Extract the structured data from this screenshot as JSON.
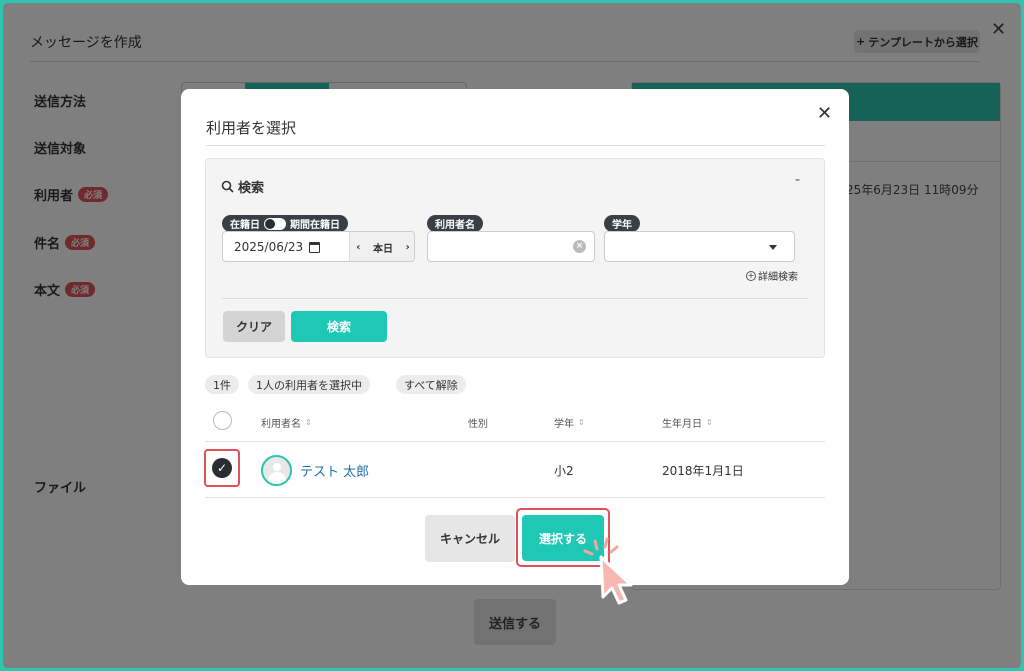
{
  "page": {
    "title": "メッセージを作成",
    "template_button": "テンプレートから選択",
    "close_symbol": "✕",
    "labels": {
      "send_method": "送信方法",
      "send_target": "送信対象",
      "user": "利用者",
      "subject": "件名",
      "body": "本文",
      "file": "ファイル"
    },
    "required_badge": "必須",
    "date_fragment": "25年6月23日 11時09分",
    "send_button": "送信する"
  },
  "modal": {
    "title": "利用者を選択",
    "close_symbol": "✕",
    "search": {
      "heading": "検索",
      "collapse_symbol": "-",
      "enrolled_label": "在籍日",
      "period_label": "期間在籍日",
      "date_value": "2025/06/23",
      "today_label": "本日",
      "prev_symbol": "‹",
      "next_symbol": "›",
      "user_name_label": "利用者名",
      "user_name_value": "",
      "grade_label": "学年",
      "grade_value": "",
      "advanced_search": "詳細検索",
      "clear_button": "クリア",
      "search_button": "検索"
    },
    "result_count": "1件",
    "selected_count": "1人の利用者を選択中",
    "deselect_all": "すべて解除",
    "table": {
      "headers": [
        "利用者名",
        "性別",
        "学年",
        "生年月日"
      ],
      "rows": [
        {
          "name": "テスト 太郎",
          "gender": "",
          "grade": "小2",
          "birthday": "2018年1月1日",
          "checked": true
        }
      ]
    },
    "cancel_button": "キャンセル",
    "select_button": "選択する"
  },
  "colors": {
    "accent": "#1fc8b4",
    "highlight": "#e0525a",
    "required": "#e0525a",
    "cursor": "#f4a6a0"
  }
}
